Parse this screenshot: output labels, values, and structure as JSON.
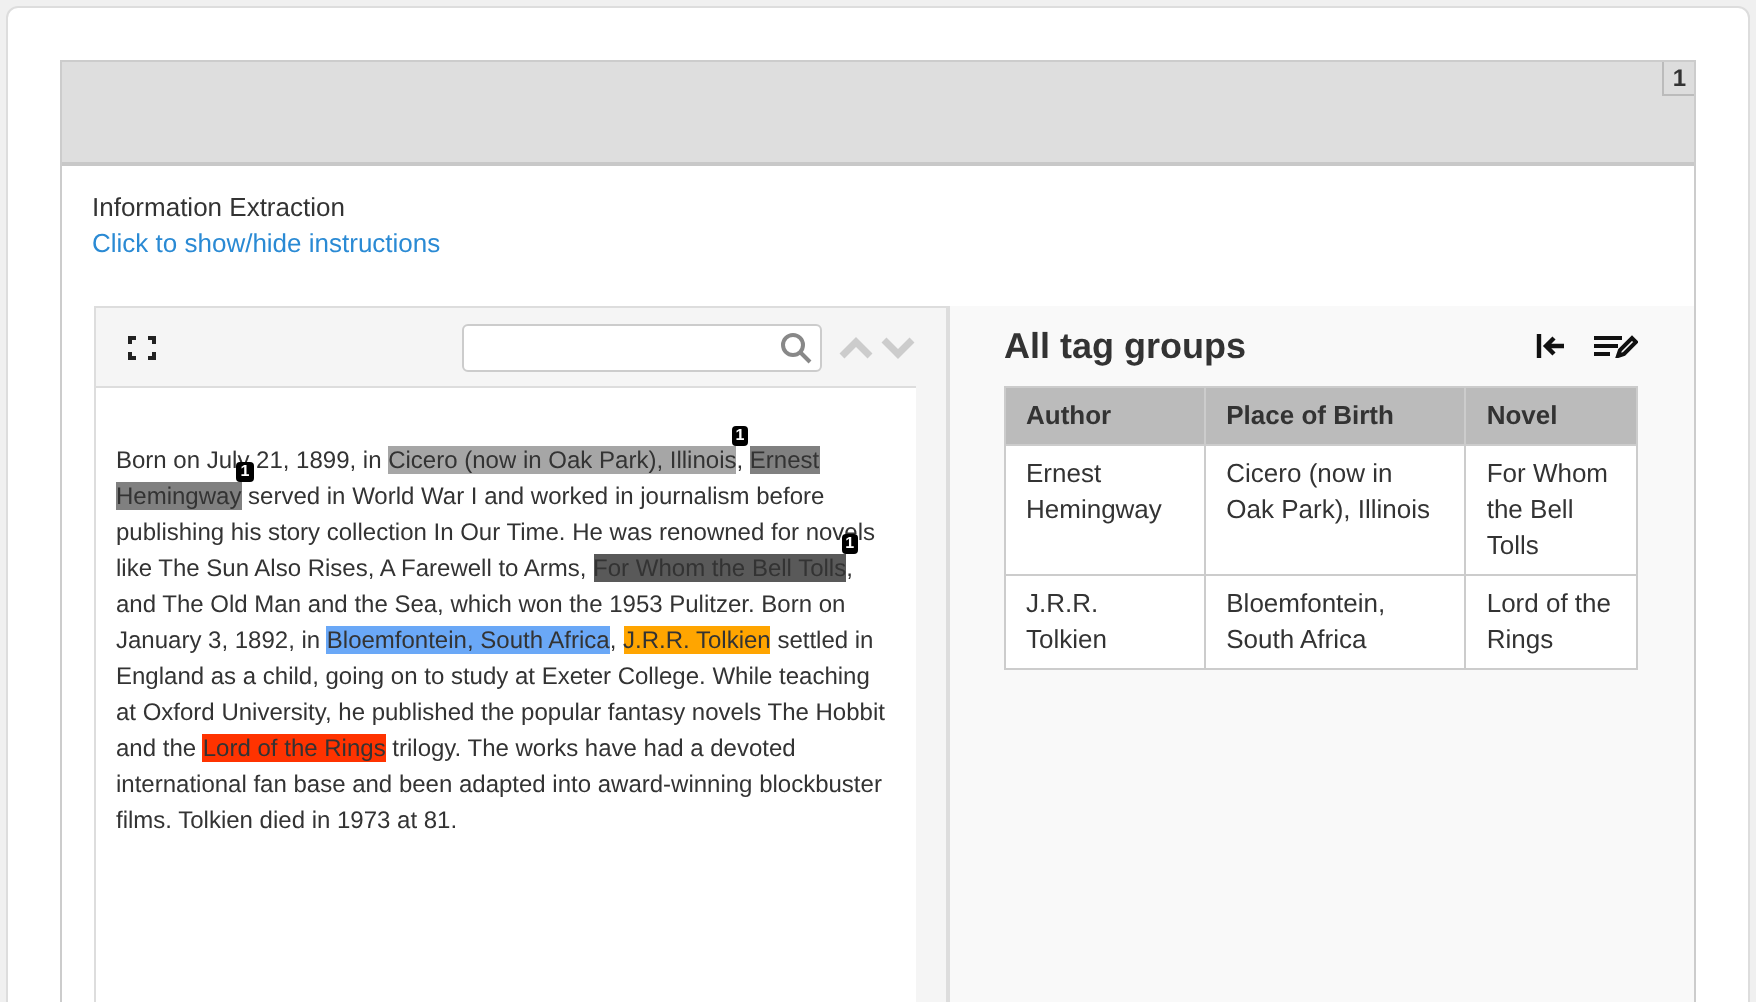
{
  "header": {
    "page_number": "1"
  },
  "title": "Information Extraction",
  "instructions_link": "Click to show/hide instructions",
  "passage": [
    {
      "text": "Born on July 21, 1899, in "
    },
    {
      "text": "Cicero (now in Oak Park), Illinois",
      "color": "#a6a6a6",
      "badge": "1"
    },
    {
      "text": ", "
    },
    {
      "text": "Ernest Hemingway",
      "color": "#808080",
      "badge": "1"
    },
    {
      "text": " served in World War I and worked in journalism before publishing his story collection In Our Time. He was renowned for novels like The Sun Also Rises, A Farewell to Arms, "
    },
    {
      "text": "For Whom the Bell Tolls",
      "color": "#595959",
      "badge": "1"
    },
    {
      "text": ", and The Old Man and the Sea, which won the 1953 Pulitzer. Born on January 3, 1892, in "
    },
    {
      "text": "Bloemfontein, South Africa",
      "color": "#6aa8f7"
    },
    {
      "text": ", "
    },
    {
      "text": "J.R.R. Tolkien",
      "color": "#ffa500"
    },
    {
      "text": " settled in England as a child, going on to study at Exeter College. While teaching at Oxford University, he published the popular fantasy novels The Hobbit and the "
    },
    {
      "text": "Lord of the Rings",
      "color": "#ff3300"
    },
    {
      "text": " trilogy. The works have had a devoted international fan base and been adapted into award-winning blockbuster films. Tolkien died in 1973 at 81."
    }
  ],
  "tag_groups": {
    "title": "All tag groups",
    "columns": [
      "Author",
      "Place of Birth",
      "Novel"
    ],
    "rows": [
      [
        "Ernest Hemingway",
        "Cicero (now in Oak Park), Illinois",
        "For Whom the Bell Tolls"
      ],
      [
        "J.R.R. Tolkien",
        "Bloemfontein, South Africa",
        "Lord of the Rings"
      ]
    ]
  }
}
